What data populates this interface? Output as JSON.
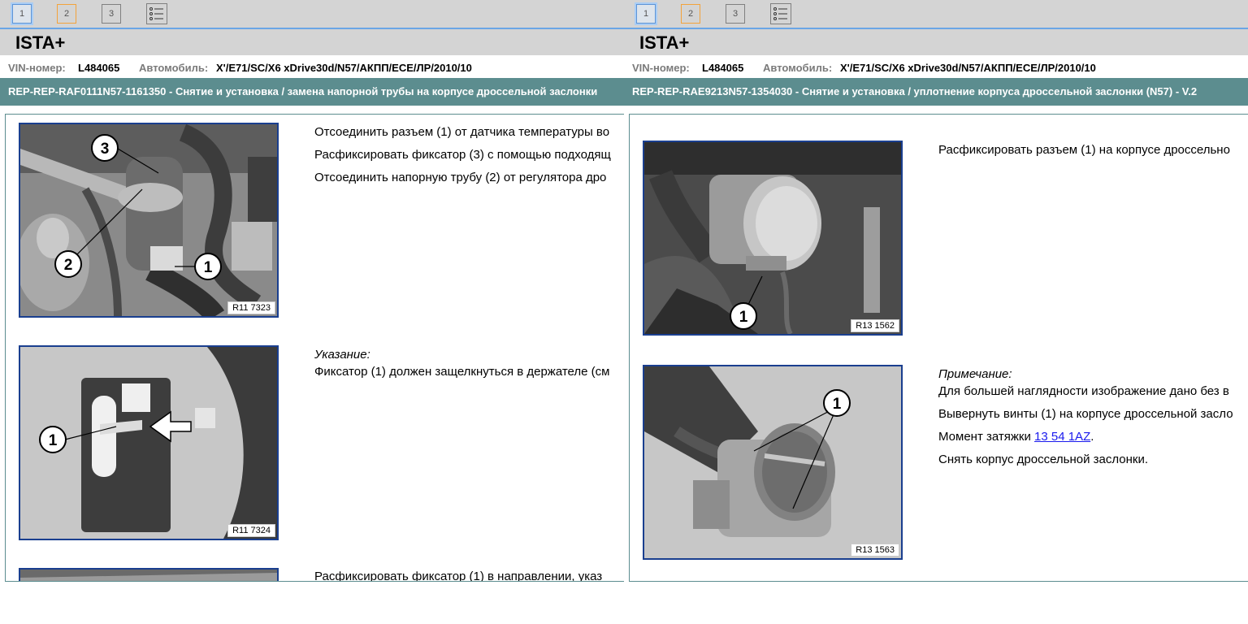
{
  "toolbar": {
    "tabs": [
      "1",
      "2",
      "3"
    ],
    "list_icon": "list-icon"
  },
  "app_title": "ISTA+",
  "vehicle": {
    "vin_label": "VIN-номер:",
    "vin_value": "L484065",
    "car_label": "Автомобиль:",
    "car_value": "X'/E71/SC/X6 xDrive30d/N57/АКПП/ECE/ЛР/2010/10"
  },
  "left": {
    "header": "REP-REP-RAF0111N57-1161350 - Снятие и установка / замена напорной трубы на корпусе дроссельной заслонки",
    "step1": {
      "figure_label": "R11 7323",
      "lines": [
        "Отсоединить разъем (1) от датчика температуры во",
        "Расфиксировать фиксатор (3) с помощью подходящ",
        "Отсоединить напорную трубу (2) от регулятора дро"
      ]
    },
    "step2": {
      "figure_label": "R11 7324",
      "note_title": "Указание:",
      "note_text": "Фиксатор (1) должен защелкнуться в держателе (см"
    },
    "step3": {
      "text": "Расфиксировать фиксатор (1) в направлении, указ"
    }
  },
  "right": {
    "header": "REP-REP-RAE9213N57-1354030 - Снятие и установка / уплотнение корпуса дроссельной заслонки (N57) - V.2",
    "step1": {
      "figure_label": "R13 1562",
      "text": "Расфиксировать разъем (1) на корпусе дроссельно"
    },
    "step2": {
      "figure_label": "R13 1563",
      "note_title": "Примечание:",
      "note_text": "Для большей наглядности изображение дано без в",
      "unscrew": "Вывернуть винты (1) на корпусе дроссельной засло",
      "torque_label": "Момент затяжки",
      "torque_link": "13 54 1AZ",
      "torque_end": ".",
      "remove": "Снять корпус дроссельной заслонки."
    }
  },
  "callouts": {
    "one": "1",
    "two": "2",
    "three": "3"
  },
  "colors": {
    "toolbar_bg": "#d4d4d4",
    "header_bg": "#5c8d8f",
    "figure_border": "#1a3f8f",
    "link": "#1a1aee",
    "tab_selected": "#5d94d6",
    "tab_orange": "#f3a33b"
  }
}
